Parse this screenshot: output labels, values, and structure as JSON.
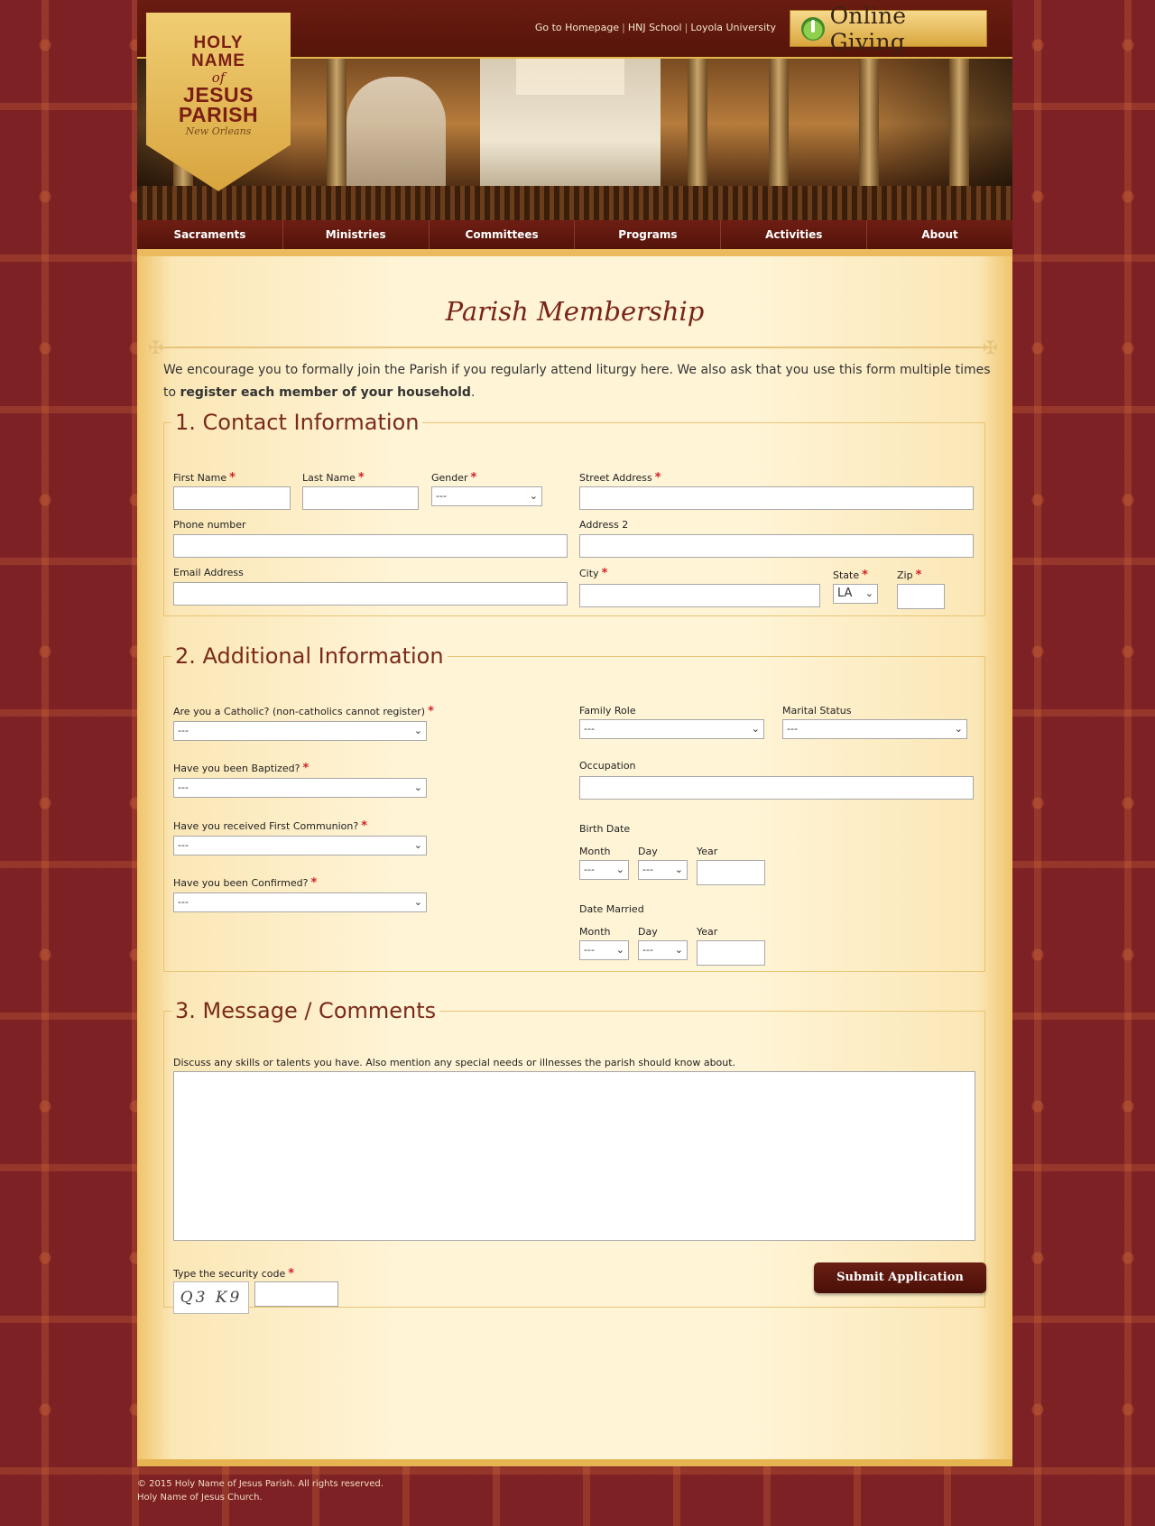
{
  "header": {
    "links": [
      "Go to Homepage",
      "HNJ School",
      "Loyola University"
    ],
    "giving_label": "Online Giving",
    "logo": {
      "line1": "HOLY",
      "line2": "NAME",
      "line3": "of",
      "line4": "JESUS",
      "line5": "PARISH",
      "line6": "New Orleans"
    }
  },
  "nav": [
    "Sacraments",
    "Ministries",
    "Committees",
    "Programs",
    "Activities",
    "About"
  ],
  "page": {
    "title": "Parish Membership",
    "intro_regular": "We encourage you to formally join the Parish if you regularly attend liturgy here. We also ask that you use this form multiple times to",
    "intro_bold": "register each member of your household",
    "intro_end": "."
  },
  "sections": {
    "contact": {
      "legend": "1. Contact Information",
      "first_name": "First Name",
      "last_name": "Last Name",
      "gender": "Gender",
      "gender_value": "---",
      "street": "Street Address",
      "phone": "Phone number",
      "address2": "Address 2",
      "email": "Email Address",
      "city": "City",
      "state": "State",
      "state_value": "LA",
      "zip": "Zip"
    },
    "additional": {
      "legend": "2. Additional Information",
      "catholic": "Are you a Catholic? (non-catholics cannot register)",
      "baptized": "Have you been Baptized?",
      "communion": "Have you received First Communion?",
      "confirmed": "Have you been Confirmed?",
      "select_default": "---",
      "family_role": "Family Role",
      "marital_status": "Marital Status",
      "occupation": "Occupation",
      "birth_date": "Birth Date",
      "date_married": "Date Married",
      "month": "Month",
      "day": "Day",
      "year": "Year"
    },
    "message": {
      "legend": "3. Message / Comments",
      "hint": "Discuss any skills or talents you have. Also mention any special needs or illnesses the parish should know about.",
      "security_label": "Type the security code",
      "captcha_text": "Q3 K9"
    }
  },
  "submit_label": "Submit Application",
  "footer": {
    "line1": "© 2015 Holy Name of Jesus Parish. All rights reserved.",
    "line2": "Holy Name of Jesus Church."
  },
  "colors": {
    "background": "#7d2124",
    "header": "#5d1810",
    "content": "#fff4d6",
    "accent": "#7a2418",
    "required": "#d2202a"
  }
}
